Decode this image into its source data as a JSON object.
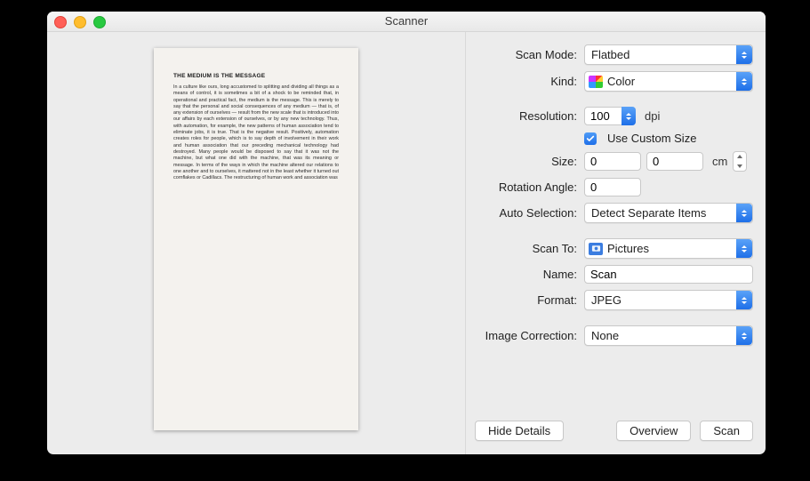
{
  "window": {
    "title": "Scanner"
  },
  "preview": {
    "doc_title": "THE MEDIUM IS THE MESSAGE",
    "doc_body": "In a culture like ours, long accustomed to splitting and dividing all things as a means of control, it is sometimes a bit of a shock to be reminded that, in operational and practical fact, the medium is the message. This is merely to say that the personal and social consequences of any medium — that is, of any extension of ourselves — result from the new scale that is introduced into our affairs by each extension of ourselves, or by any new technology. Thus, with automation, for example, the new patterns of human association tend to eliminate jobs, it is true. That is the negative result. Positively, automation creates roles for people, which is to say depth of involvement in their work and human association that our preceding mechanical technology had destroyed. Many people would be disposed to say that it was not the machine, but what one did with the machine, that was its meaning or message. In terms of the ways in which the machine altered our relations to one another and to ourselves, it mattered not in the least whether it turned out cornflakes or Cadillacs. The restructuring of human work and association was"
  },
  "labels": {
    "scan_mode": "Scan Mode:",
    "kind": "Kind:",
    "resolution": "Resolution:",
    "dpi": "dpi",
    "use_custom_size": "Use Custom Size",
    "size": "Size:",
    "cm": "cm",
    "rotation_angle": "Rotation Angle:",
    "auto_selection": "Auto Selection:",
    "scan_to": "Scan To:",
    "name": "Name:",
    "format": "Format:",
    "image_correction": "Image Correction:"
  },
  "values": {
    "scan_mode": "Flatbed",
    "kind": "Color",
    "resolution": "100",
    "size_w": "0",
    "size_h": "0",
    "rotation_angle": "0",
    "auto_selection": "Detect Separate Items",
    "scan_to": "Pictures",
    "name": "Scan",
    "format": "JPEG",
    "image_correction": "None",
    "use_custom_size_checked": true
  },
  "buttons": {
    "hide_details": "Hide Details",
    "overview": "Overview",
    "scan": "Scan"
  }
}
